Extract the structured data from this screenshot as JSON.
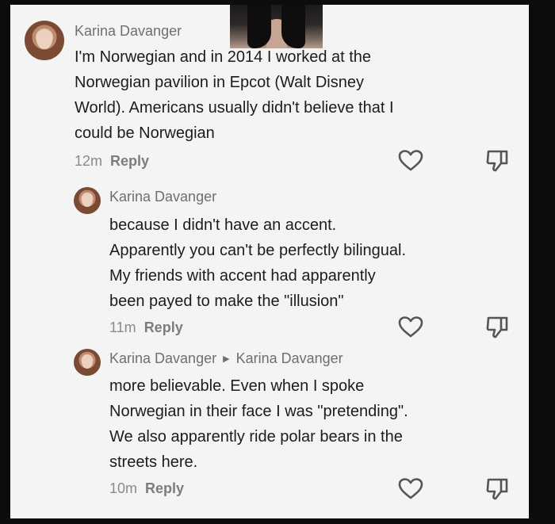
{
  "comments": [
    {
      "author": "Karina Davanger",
      "lines": [
        "I'm Norwegian and in 2014 I worked at the",
        "Norwegian pavilion in Epcot (Walt Disney",
        "World). Americans usually didn't believe that I",
        "could be Norwegian"
      ],
      "time": "12m",
      "reply_label": "Reply"
    },
    {
      "author": "Karina Davanger",
      "lines": [
        "because I didn't have an accent.",
        "Apparently you can't be perfectly bilingual.",
        "My friends with accent had apparently",
        "been payed to make the \"illusion\""
      ],
      "time": "11m",
      "reply_label": "Reply"
    },
    {
      "author": "Karina Davanger",
      "reply_to": "Karina Davanger",
      "lines": [
        "more believable. Even when I spoke",
        "Norwegian in their face I was \"pretending\".",
        "We also apparently ride polar bears in the",
        "streets here."
      ],
      "time": "10m",
      "reply_label": "Reply"
    }
  ],
  "icons": {
    "like": "heart-outline-icon",
    "dislike": "thumbs-down-icon"
  }
}
